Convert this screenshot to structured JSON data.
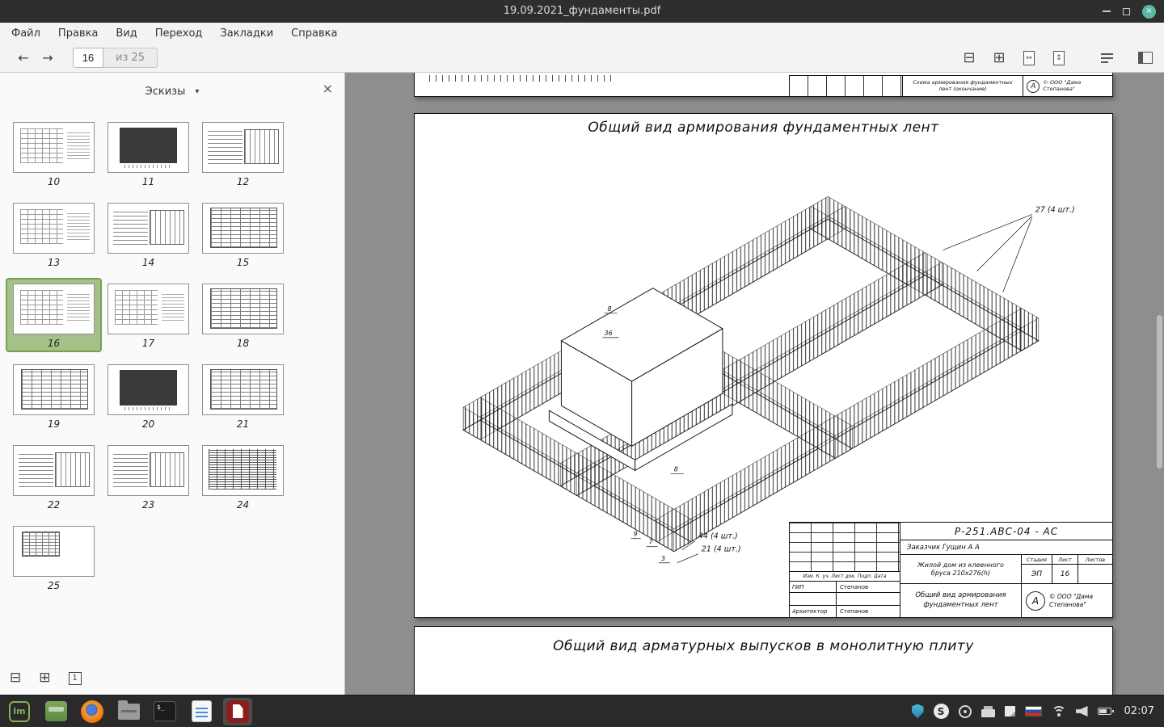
{
  "window": {
    "title": "19.09.2021_фундаменты.pdf"
  },
  "menubar": {
    "items": [
      "Файл",
      "Правка",
      "Вид",
      "Переход",
      "Закладки",
      "Справка"
    ]
  },
  "toolbar": {
    "page_value": "16",
    "page_total": "из 25"
  },
  "icons": {
    "back": "←",
    "forward": "→",
    "zoom_out": "⊟",
    "zoom_in": "⊞",
    "fit_width": "↔",
    "fit_page": "↕",
    "dropdown": "▾",
    "sidebar_close": "×",
    "window_close": "×",
    "thumb_zoom_out": "⊟",
    "thumb_zoom_in": "⊞",
    "thumb_actual": "1",
    "mint_logo": "lm",
    "terminal_prompt": "$_",
    "skype_letter": "S"
  },
  "sidebar": {
    "mode": "Эскизы",
    "thumbnails": [
      {
        "label": "10",
        "variant": "plan"
      },
      {
        "label": "11",
        "variant": "dark"
      },
      {
        "label": "12",
        "variant": "mixed"
      },
      {
        "label": "13",
        "variant": "plan"
      },
      {
        "label": "14",
        "variant": "mixed"
      },
      {
        "label": "15",
        "variant": "table"
      },
      {
        "label": "16",
        "variant": "plan",
        "selected": true
      },
      {
        "label": "17",
        "variant": "plan"
      },
      {
        "label": "18",
        "variant": "table"
      },
      {
        "label": "19",
        "variant": "table"
      },
      {
        "label": "20",
        "variant": "dark"
      },
      {
        "label": "21",
        "variant": "table"
      },
      {
        "label": "22",
        "variant": "mixed"
      },
      {
        "label": "23",
        "variant": "mixed"
      },
      {
        "label": "24",
        "variant": "dense"
      },
      {
        "label": "25",
        "variant": "small"
      }
    ]
  },
  "document": {
    "prev_page": {
      "caption": "Схема армирования фундаментных лент (окончание)",
      "company": "© ООО \"Дама Степанова\""
    },
    "main_page": {
      "title": "Общий вид армирования фундаментных лент",
      "ann_27": "27 (4 шт.)",
      "ann_44": "44 (4 шт.)",
      "ann_21": "21 (4 шт.)",
      "mark_8a": "8",
      "mark_36": "36",
      "mark_8b": "8",
      "mark_9": "9",
      "mark_7": "7",
      "mark_3": "3",
      "titleblock": {
        "doc_number": "Р-251.АВС-04 - АС",
        "client": "Заказчик  Гущин А А",
        "columns": "Изм.  К. уч.  Лист   док.  Подп.  Дата",
        "gip_label": "ГИП",
        "gip_name": "Степанов",
        "architect_label": "Архитектор",
        "architect_name": "Степанов",
        "object_name": "Жилой дом из клеенного бруса 210х276(h)",
        "stage_label": "Стадия",
        "sheet_label": "Лист",
        "sheets_label": "Листов",
        "stage_value": "ЭП",
        "sheet_value": "16",
        "sheet_title": "Общий вид армирования фундаментных лент",
        "logo_letter": "А",
        "company": "© ООО \"Дама Степанова\""
      }
    },
    "next_page": {
      "title": "Общий вид арматурных выпусков в монолитную плиту"
    }
  },
  "taskbar": {
    "clock": "02:07"
  }
}
